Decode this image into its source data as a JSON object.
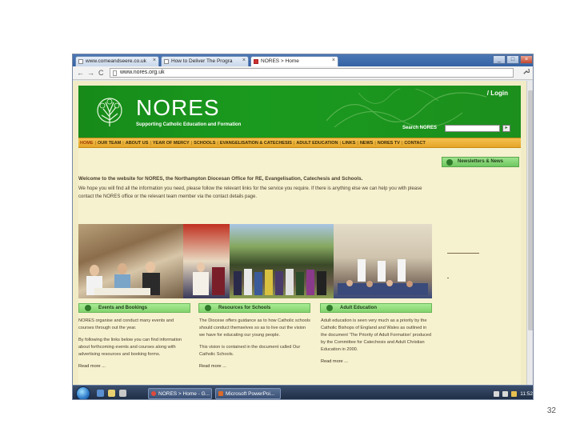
{
  "browser": {
    "tabs": [
      {
        "label": "www.comeandseere.co.uk"
      },
      {
        "label": "How to Deliver The Progra"
      },
      {
        "label": "NORES > Home"
      }
    ],
    "tab_close": "×",
    "window_buttons": {
      "minimize": "_",
      "maximize": "□",
      "close": "×"
    },
    "nav": {
      "back": "←",
      "forward": "→",
      "reload": "C"
    },
    "address": "www.nores.org.uk",
    "menu_icon": "wrench-icon"
  },
  "site": {
    "login": "/ Login",
    "name": "NORES",
    "tagline": "Supporting Catholic Education and Formation",
    "search_label": "Search NORES",
    "search_go": "▸",
    "nav": [
      "HOME",
      "OUR TEAM",
      "ABOUT US",
      "YEAR OF MERCY",
      "SCHOOLS",
      "EVANGELISATION & CATECHESIS",
      "ADULT EDUCATION",
      "LINKS",
      "NEWS",
      "NORES TV",
      "CONTACT"
    ],
    "nav_separator": "|",
    "newsletters": "Newsletters & News",
    "welcome_title": "Welcome to the website for NORES, the Northampton Diocesan Office for RE, Evangelisation, Catechesis and Schools.",
    "welcome_text": "We hope you will find all the information you need, please follow the relevant links for the service you require. If there is anything else we can help you with please contact the NORES office or the relevant team member via the contact details page.",
    "sections": [
      {
        "title": "Events and Bookings",
        "paragraphs": [
          "NORES organise and conduct many events and courses through out the year.",
          "By following the links below you can find information about forthcoming events and courses along with advertising resources and booking forms."
        ],
        "more": "Read more ..."
      },
      {
        "title": "Resources for Schools",
        "paragraphs": [
          "The Diocese offers guidance as to how Catholic schools should conduct themselves so as to live out the vision we have for educating our young people.",
          "This vision is contained in the document called Our Catholic Schools."
        ],
        "more": "Read more ..."
      },
      {
        "title": "Adult Education",
        "paragraphs": [
          "Adult education is seen very much as a priority by the Catholic Bishops of England and Wales as outlined in the document 'The Priority of Adult Formation' produced by the Committee for Catechesis and Adult Christian Education in 2000."
        ],
        "more": "Read more ..."
      }
    ]
  },
  "taskbar": {
    "tasks": [
      {
        "label": "NORES > Home - G..."
      },
      {
        "label": "Microsoft PowerPoi..."
      }
    ],
    "clock": "11:52"
  },
  "slide": {
    "number": "32"
  },
  "colors": {
    "header_green": "#1a9a1e",
    "nav_orange": "#e5a526",
    "page_bg": "#f6f1cf",
    "section_green": "#9be386"
  }
}
